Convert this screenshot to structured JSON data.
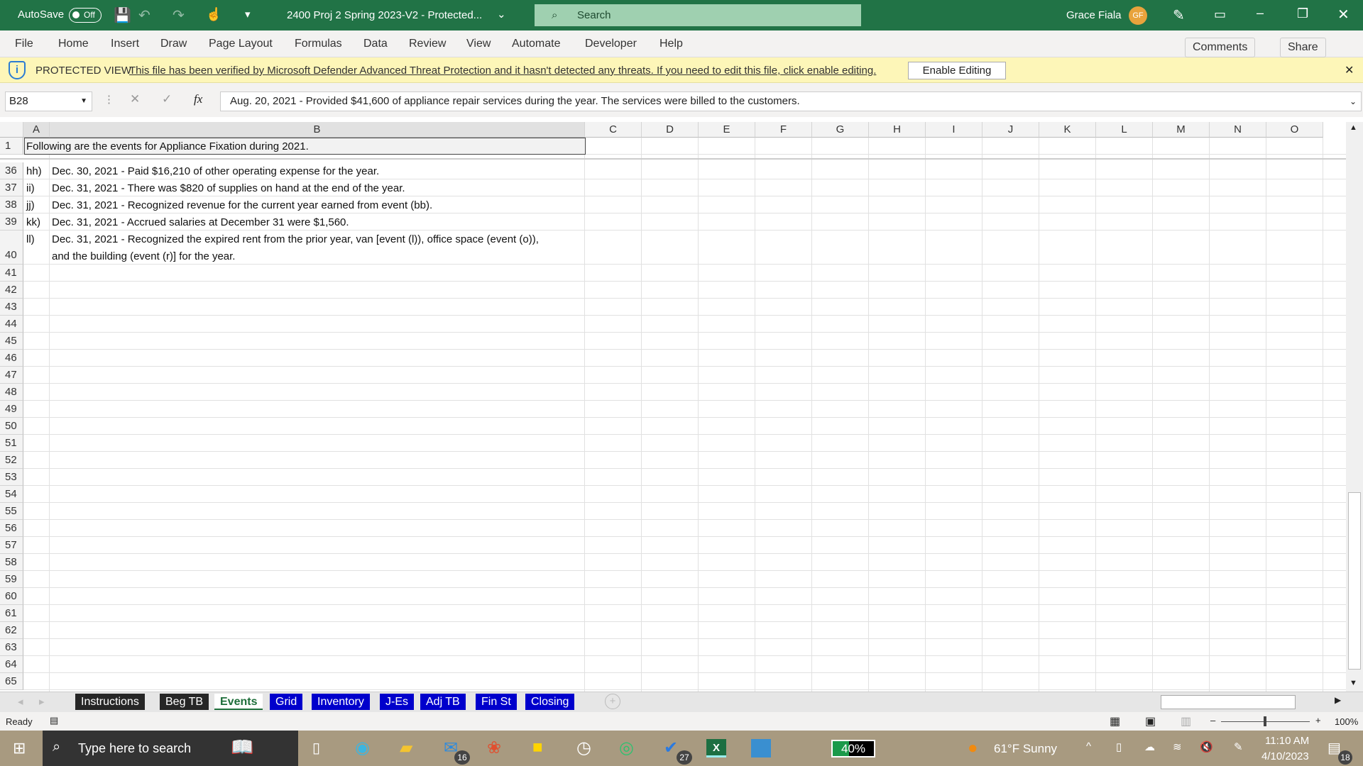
{
  "titlebar": {
    "autosave_label": "AutoSave",
    "autosave_state": "Off",
    "filename": "2400 Proj 2 Spring 2023-V2  -  Protected...",
    "search_placeholder": "Search",
    "user_name": "Grace Fiala",
    "user_initials": "GF"
  },
  "ribbon": {
    "tabs": [
      "File",
      "Home",
      "Insert",
      "Draw",
      "Page Layout",
      "Formulas",
      "Data",
      "Review",
      "View",
      "Automate",
      "Developer",
      "Help"
    ],
    "comments": "Comments",
    "share": "Share"
  },
  "protected_view": {
    "label": "PROTECTED VIEW",
    "message": "This file has been verified by Microsoft Defender Advanced Threat Protection and it hasn't detected any threats. If you need to edit this file, click enable editing.",
    "button": "Enable Editing"
  },
  "formula_bar": {
    "name_box": "B28",
    "fx": "fx",
    "formula": "Aug. 20, 2021 - Provided $41,600 of appliance repair services during the year. The services were billed to the customers."
  },
  "columns": [
    "A",
    "B",
    "C",
    "D",
    "E",
    "F",
    "G",
    "H",
    "I",
    "J",
    "K",
    "L",
    "M",
    "N",
    "O"
  ],
  "rows": [
    {
      "n": "1",
      "a": "Following are the events for Appliance Fixation during 2021.",
      "b": ""
    },
    {
      "n": "36",
      "a": "hh)",
      "b": "Dec. 30, 2021 - Paid $16,210 of other operating expense for the year."
    },
    {
      "n": "37",
      "a": "ii)",
      "b": "Dec. 31, 2021 - There was $820 of supplies on hand at the end of the year."
    },
    {
      "n": "38",
      "a": "jj)",
      "b": "Dec. 31, 2021 - Recognized revenue for the current year earned from event (bb)."
    },
    {
      "n": "39",
      "a": "kk)",
      "b": "Dec. 31, 2021 - Accrued salaries at December 31 were $1,560."
    },
    {
      "n": "40",
      "a": "ll)",
      "b": "Dec. 31, 2021 - Recognized the expired rent from the prior year, van [event (l)), office space (event (o)),",
      "b2": "and the building (event (r)] for the year."
    },
    {
      "n": "41"
    },
    {
      "n": "42"
    },
    {
      "n": "43"
    },
    {
      "n": "44"
    },
    {
      "n": "45"
    },
    {
      "n": "46"
    },
    {
      "n": "47"
    },
    {
      "n": "48"
    },
    {
      "n": "49"
    },
    {
      "n": "50"
    },
    {
      "n": "51"
    },
    {
      "n": "52"
    },
    {
      "n": "53"
    },
    {
      "n": "54"
    },
    {
      "n": "55"
    },
    {
      "n": "56"
    },
    {
      "n": "57"
    },
    {
      "n": "58"
    },
    {
      "n": "59"
    },
    {
      "n": "60"
    },
    {
      "n": "61"
    },
    {
      "n": "62"
    },
    {
      "n": "63"
    },
    {
      "n": "64"
    },
    {
      "n": "65"
    }
  ],
  "sheet_tabs": [
    {
      "label": "Instructions",
      "color": "#262626"
    },
    {
      "label": "Beg TB",
      "color": "#262626"
    },
    {
      "label": "Events",
      "color": "active"
    },
    {
      "label": "Grid",
      "color": "#0000cc"
    },
    {
      "label": "Inventory",
      "color": "#0000cc"
    },
    {
      "label": "J-Es",
      "color": "#0000cc"
    },
    {
      "label": "Adj TB",
      "color": "#0000cc"
    },
    {
      "label": "Fin St",
      "color": "#0000cc"
    },
    {
      "label": "Closing",
      "color": "#0000cc"
    }
  ],
  "status": {
    "ready": "Ready",
    "zoom": "100%"
  },
  "taskbar": {
    "search_placeholder": "Type here to search",
    "mail_badge": "16",
    "todo_badge": "27",
    "battery": "40%",
    "weather": "61°F  Sunny",
    "time": "11:10 AM",
    "date": "4/10/2023",
    "notif_badge": "18"
  },
  "colors": {
    "excel_green": "#217346",
    "protected_bg": "#fdf6b8",
    "tab_blue": "#0000cc",
    "tab_dark": "#262626"
  }
}
